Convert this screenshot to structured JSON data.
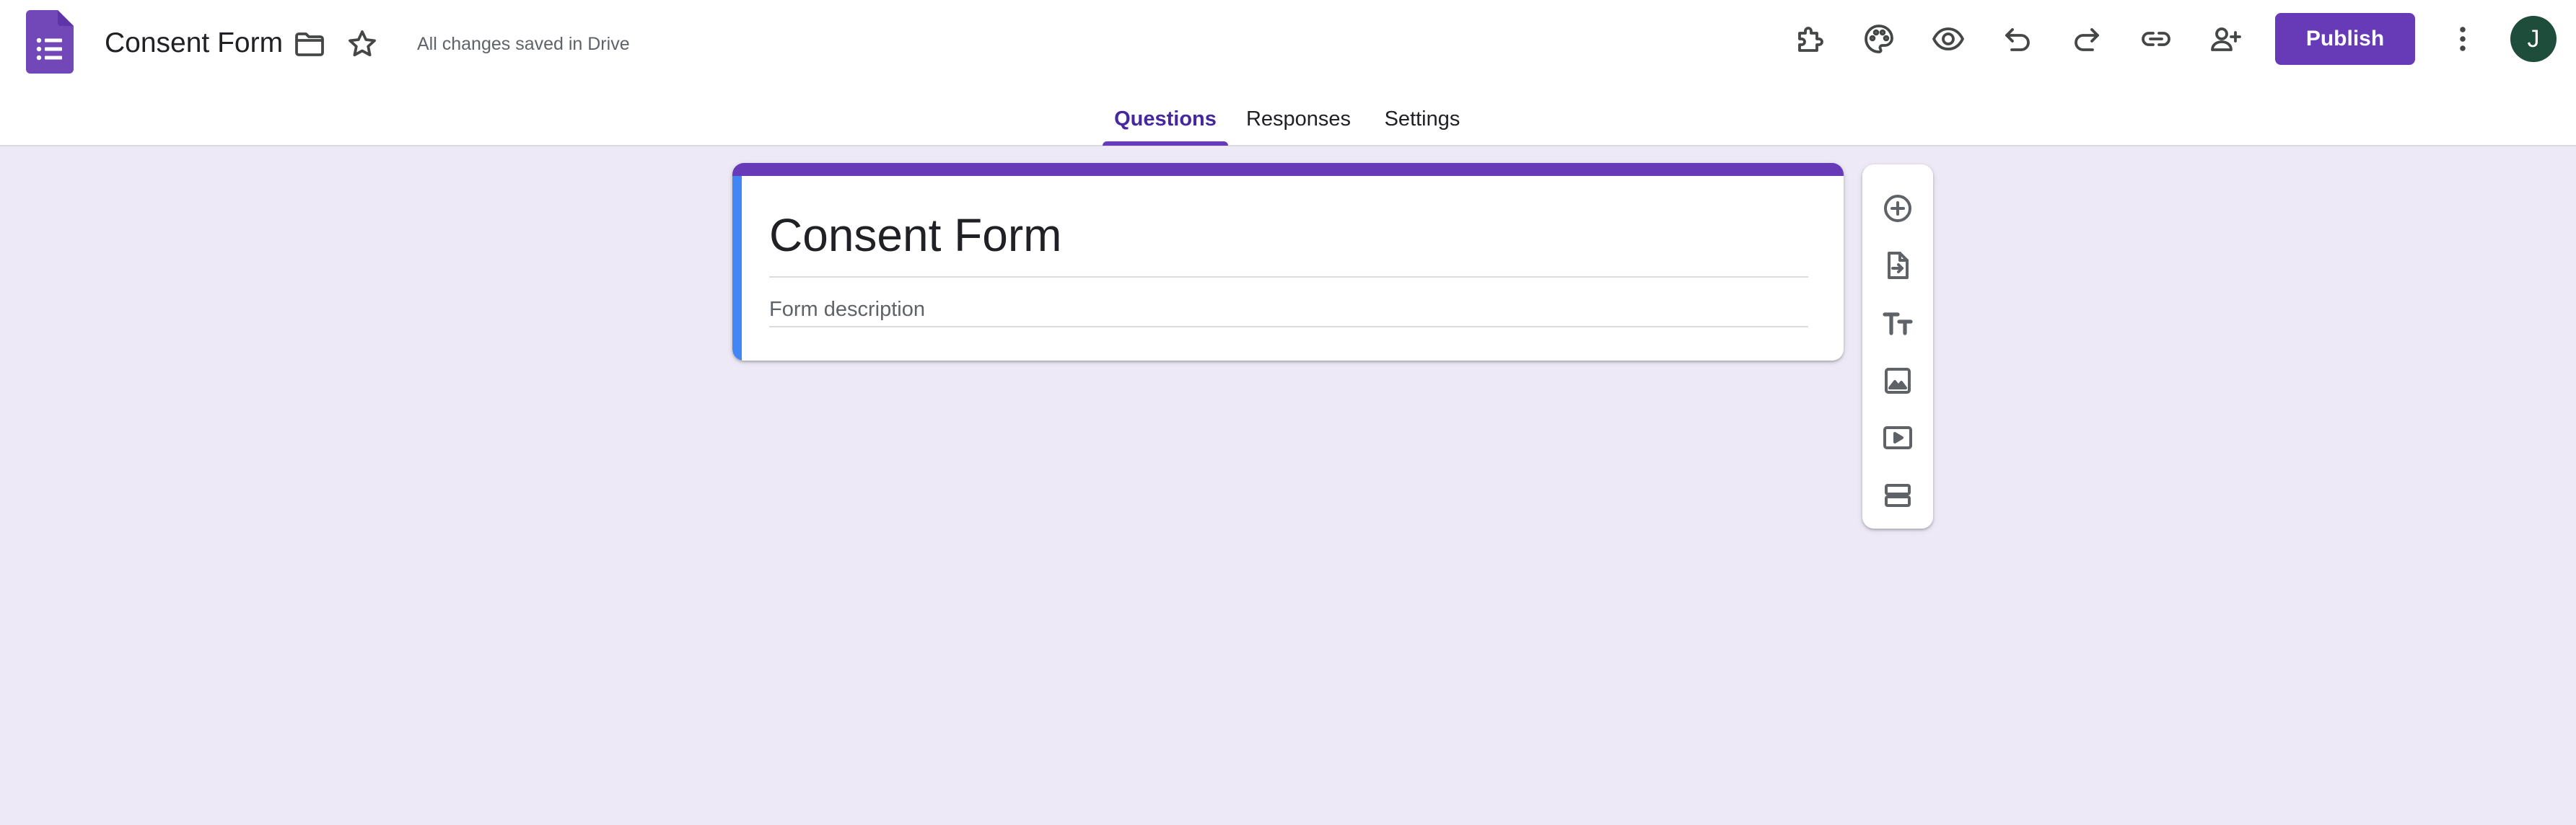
{
  "header": {
    "app_icon": "google-forms-icon",
    "doc_title": "Consent Form",
    "folder_icon": "folder-icon",
    "star_icon": "star-icon",
    "save_status": "All changes saved in Drive",
    "toolbar_icons": [
      "add-ons-puzzle-icon",
      "palette-icon",
      "preview-eye-icon",
      "undo-icon",
      "redo-icon",
      "link-icon",
      "add-collaborator-icon"
    ],
    "publish_label": "Publish",
    "more_icon": "more-vert-icon",
    "avatar_initial": "J"
  },
  "tabs": [
    {
      "label": "Questions",
      "active": true
    },
    {
      "label": "Responses",
      "active": false
    },
    {
      "label": "Settings",
      "active": false
    }
  ],
  "form": {
    "title": "Consent Form",
    "description_placeholder": "Form description"
  },
  "side_toolbar": {
    "tools": [
      "add-question-icon",
      "import-questions-icon",
      "add-title-description-icon",
      "add-image-icon",
      "add-video-icon",
      "add-section-icon"
    ]
  },
  "colors": {
    "accent": "#673ab7",
    "card_left_accent": "#4285f4",
    "background": "#ede9f6",
    "avatar": "#1e4d3b"
  }
}
